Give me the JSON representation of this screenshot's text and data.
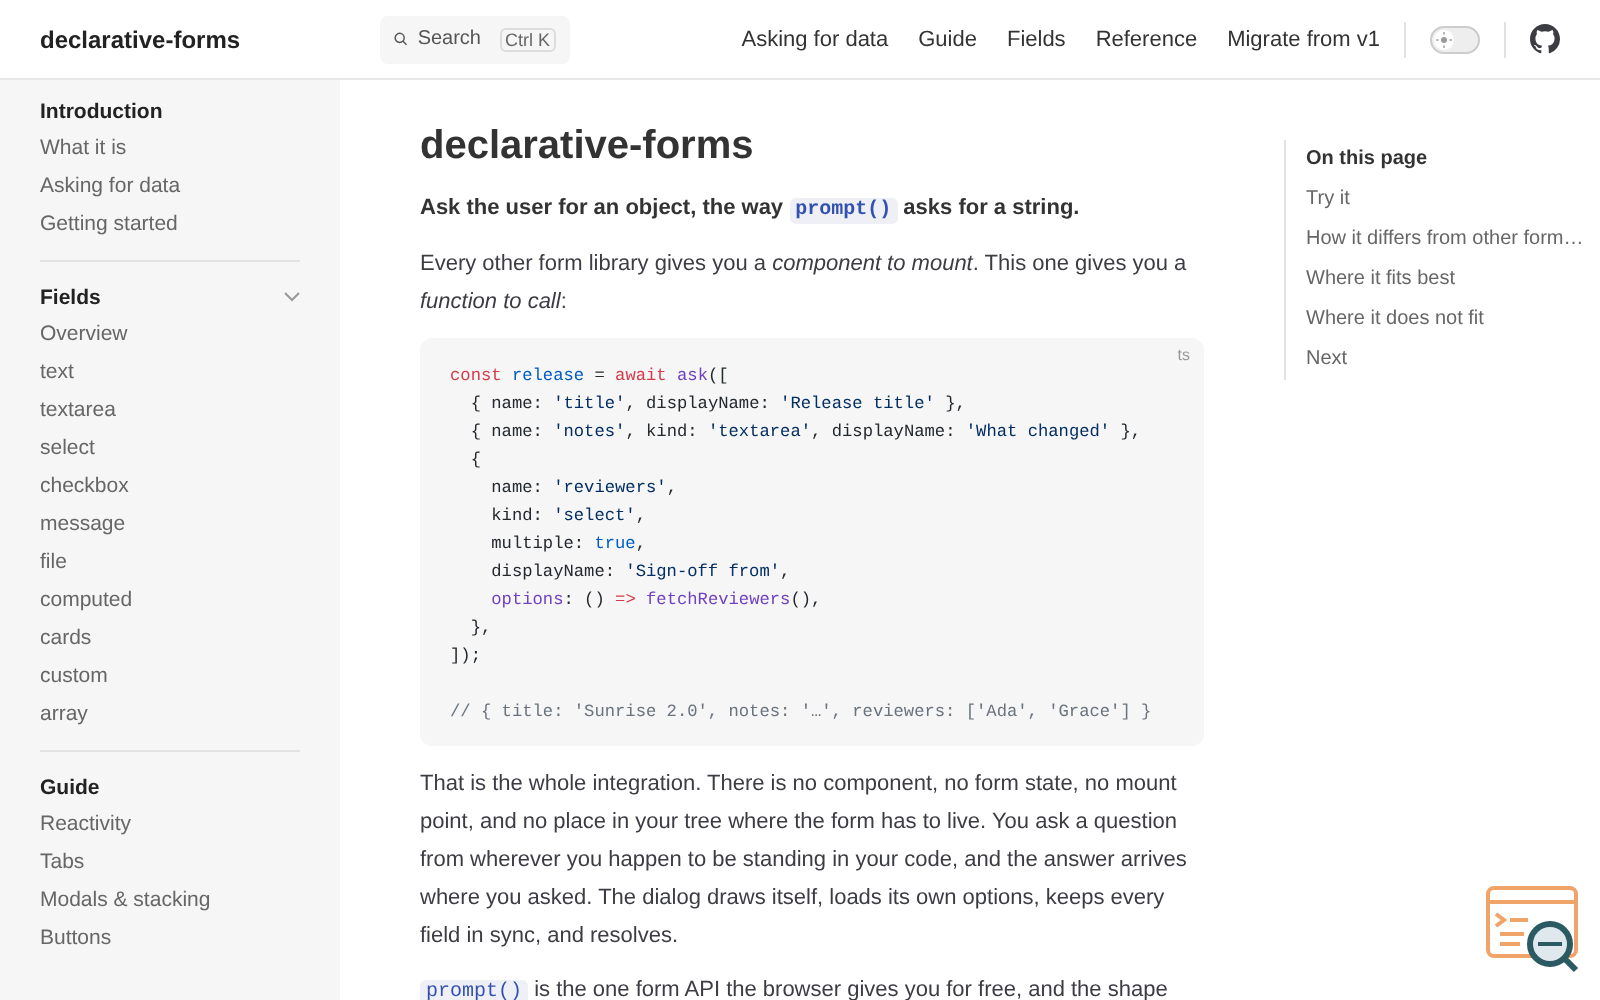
{
  "header": {
    "logo": "declarative-forms",
    "search": {
      "placeholder": "Search",
      "shortcut": "Ctrl K"
    },
    "nav": [
      "Asking for data",
      "Guide",
      "Fields",
      "Reference",
      "Migrate from v1"
    ],
    "theme_switch": {
      "on": false
    }
  },
  "sidebar": {
    "groups": [
      {
        "title": "Introduction",
        "collapsible": false,
        "items": [
          "What it is",
          "Asking for data",
          "Getting started"
        ]
      },
      {
        "title": "Fields",
        "collapsible": true,
        "items": [
          "Overview",
          "text",
          "textarea",
          "select",
          "checkbox",
          "message",
          "file",
          "computed",
          "cards",
          "custom",
          "array"
        ]
      },
      {
        "title": "Guide",
        "collapsible": false,
        "items": [
          "Reactivity",
          "Tabs",
          "Modals & stacking",
          "Buttons"
        ]
      }
    ]
  },
  "article": {
    "title": "declarative-forms",
    "lead": [
      {
        "kind": "text",
        "text": "Ask the user for an object, the way "
      },
      {
        "kind": "code",
        "text": "prompt()"
      },
      {
        "kind": "text",
        "text": " asks for a string."
      }
    ],
    "intro": [
      {
        "kind": "text",
        "text": "Every other form library gives you a "
      },
      {
        "kind": "em",
        "text": "component to mount"
      },
      {
        "kind": "text",
        "text": ". This one gives you a "
      },
      {
        "kind": "em",
        "text": "function to call"
      },
      {
        "kind": "text",
        "text": ":"
      }
    ],
    "code": {
      "lang": "ts",
      "lines": [
        [
          {
            "kind": "keyword",
            "text": "const "
          },
          {
            "kind": "variable",
            "text": "release"
          },
          {
            "kind": "plain",
            "text": " = "
          },
          {
            "kind": "keyword",
            "text": "await "
          },
          {
            "kind": "function",
            "text": "ask"
          },
          {
            "kind": "plain",
            "text": "(["
          }
        ],
        [
          {
            "kind": "plain",
            "text": "  { name: "
          },
          {
            "kind": "string",
            "text": "'title'"
          },
          {
            "kind": "plain",
            "text": ", displayName: "
          },
          {
            "kind": "string",
            "text": "'Release title'"
          },
          {
            "kind": "plain",
            "text": " },"
          }
        ],
        [
          {
            "kind": "plain",
            "text": "  { name: "
          },
          {
            "kind": "string",
            "text": "'notes'"
          },
          {
            "kind": "plain",
            "text": ", kind: "
          },
          {
            "kind": "string",
            "text": "'textarea'"
          },
          {
            "kind": "plain",
            "text": ", displayName: "
          },
          {
            "kind": "string",
            "text": "'What changed'"
          },
          {
            "kind": "plain",
            "text": " },"
          }
        ],
        [
          {
            "kind": "plain",
            "text": "  {"
          }
        ],
        [
          {
            "kind": "plain",
            "text": "    name: "
          },
          {
            "kind": "string",
            "text": "'reviewers'"
          },
          {
            "kind": "plain",
            "text": ","
          }
        ],
        [
          {
            "kind": "plain",
            "text": "    kind: "
          },
          {
            "kind": "string",
            "text": "'select'"
          },
          {
            "kind": "plain",
            "text": ","
          }
        ],
        [
          {
            "kind": "plain",
            "text": "    multiple: "
          },
          {
            "kind": "variable",
            "text": "true"
          },
          {
            "kind": "plain",
            "text": ","
          }
        ],
        [
          {
            "kind": "plain",
            "text": "    displayName: "
          },
          {
            "kind": "string",
            "text": "'Sign-off from'"
          },
          {
            "kind": "plain",
            "text": ","
          }
        ],
        [
          {
            "kind": "function",
            "text": "    options"
          },
          {
            "kind": "plain",
            "text": ": () "
          },
          {
            "kind": "keyword",
            "text": "=>"
          },
          {
            "kind": "function",
            "text": " fetchReviewers"
          },
          {
            "kind": "plain",
            "text": "(),"
          }
        ],
        [
          {
            "kind": "plain",
            "text": "  },"
          }
        ],
        [
          {
            "kind": "plain",
            "text": "]);"
          }
        ],
        [
          {
            "kind": "comment",
            "text": "// { title: 'Sunrise 2.0', notes: '…', reviewers: ['Ada', 'Grace'] }"
          }
        ]
      ]
    },
    "paragraphs": [
      [
        {
          "kind": "text",
          "text": "That is the whole integration. There is no component, no form state, no mount point, and no place in your tree where the form has to live. You ask a question from wherever you happen to be standing in your code, and the answer arrives where you asked. The dialog draws itself, loads its own options, keeps every field in sync, and resolves."
        }
      ],
      [
        {
          "kind": "code",
          "text": "prompt()"
        },
        {
          "kind": "text",
          "text": " is the one form API the browser gives you for free, and the shape"
        }
      ]
    ]
  },
  "toc": {
    "title": "On this page",
    "items": [
      "Try it",
      "How it differs from other form…",
      "Where it fits best",
      "Where it does not fit",
      "Next"
    ]
  }
}
